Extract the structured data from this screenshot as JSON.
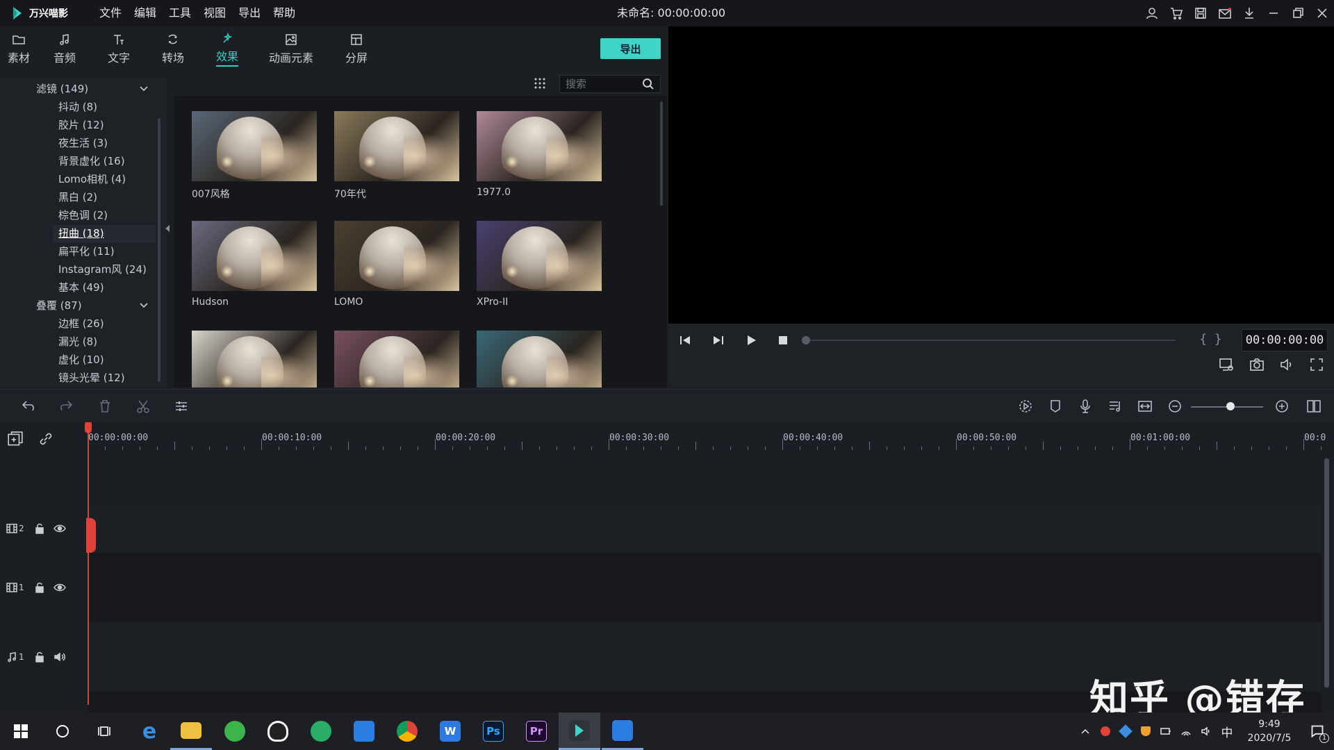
{
  "app": {
    "logo_text": "万兴喵影",
    "menu": [
      "文件",
      "编辑",
      "工具",
      "视图",
      "导出",
      "帮助"
    ],
    "doc_title": "未命名: 00:00:00:00"
  },
  "media_tabs": [
    {
      "label": "素材",
      "icon": "folder-icon"
    },
    {
      "label": "音频",
      "icon": "music-icon"
    },
    {
      "label": "文字",
      "icon": "text-icon"
    },
    {
      "label": "转场",
      "icon": "transition-icon"
    },
    {
      "label": "效果",
      "icon": "effects-icon",
      "active": true
    },
    {
      "label": "动画元素",
      "icon": "image-icon"
    },
    {
      "label": "分屏",
      "icon": "split-screen-icon"
    }
  ],
  "export_label": "导出",
  "tree": {
    "categories": [
      {
        "label": "滤镜 (149)",
        "items": [
          "抖动 (8)",
          "胶片 (12)",
          "夜生活 (3)",
          "背景虚化 (16)",
          "Lomo相机 (4)",
          "黑白 (2)",
          "棕色调 (2)",
          "扭曲 (18)",
          "扁平化 (11)",
          "Instagram风 (24)",
          "基本 (49)"
        ]
      },
      {
        "label": "叠覆 (87)",
        "items": [
          "边框 (26)",
          "漏光 (8)",
          "虚化 (10)",
          "镜头光晕 (12)"
        ]
      }
    ],
    "selected": "扭曲 (18)"
  },
  "search": {
    "placeholder": "搜索"
  },
  "effects": [
    {
      "label": "007风格",
      "tone": "#5a6878"
    },
    {
      "label": "70年代",
      "tone": "#8a7a5a"
    },
    {
      "label": "1977.0",
      "tone": "#b08a98"
    },
    {
      "label": "Hudson",
      "tone": "#6a6a80"
    },
    {
      "label": "LOMO",
      "tone": "#4a4030"
    },
    {
      "label": "XPro-II",
      "tone": "#4a4070"
    },
    {
      "label": "",
      "tone": "#d8d4cc"
    },
    {
      "label": "",
      "tone": "#7a5060"
    },
    {
      "label": "",
      "tone": "#3a6878"
    }
  ],
  "player": {
    "timecode": "00:00:00:00",
    "progress": 0
  },
  "timeline": {
    "ruler_labels": [
      "00:00:00:00",
      "00:00:10:00",
      "00:00:20:00",
      "00:00:30:00",
      "00:00:40:00",
      "00:00:50:00",
      "00:01:00:00",
      "00:0"
    ],
    "tracks": [
      {
        "type": "video",
        "number": "2"
      },
      {
        "type": "video",
        "number": "1"
      },
      {
        "type": "audio",
        "number": "1"
      }
    ],
    "zoom_level": 0.55
  },
  "watermark": "知乎 @错存",
  "taskbar": {
    "apps": [
      "start-icon",
      "search-icon",
      "task-view-icon",
      "edge-icon",
      "explorer-icon",
      "browser-icon",
      "qq-icon",
      "wechat-icon",
      "netdisk-icon",
      "chrome-icon",
      "wps-icon",
      "photoshop-icon",
      "premiere-icon",
      "filmora-icon",
      "phone-icon"
    ],
    "ps_label": "Ps",
    "pr_label": "Pr",
    "ime": "中",
    "time": "9:49",
    "date": "2020/7/5",
    "notification_count": "1"
  }
}
